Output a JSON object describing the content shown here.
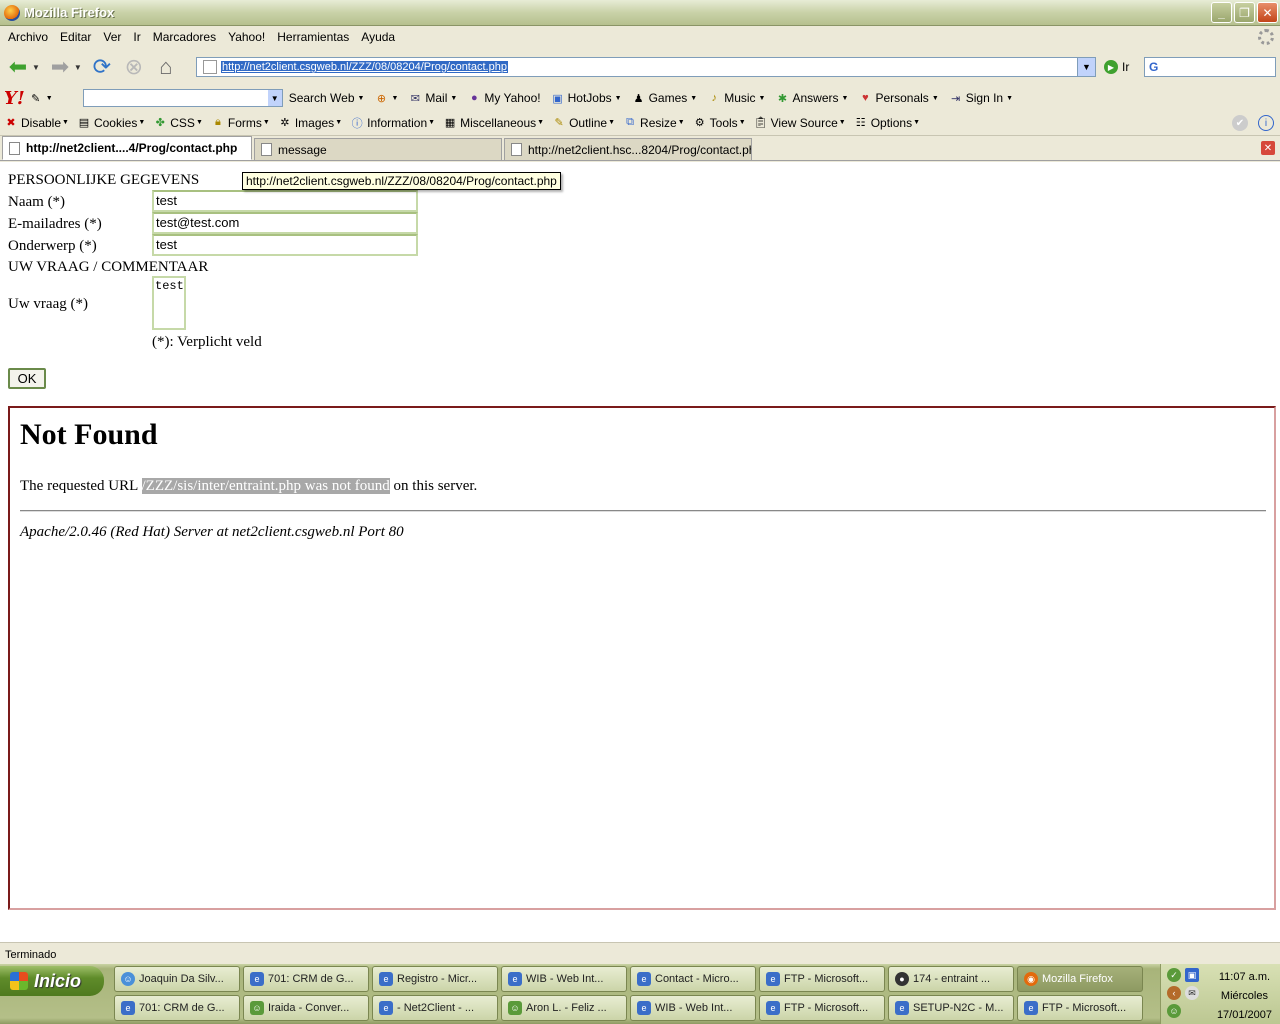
{
  "window": {
    "title": "Mozilla Firefox",
    "buttons": [
      "_",
      "❐",
      "✕"
    ]
  },
  "menu": [
    "Archivo",
    "Editar",
    "Ver",
    "Ir",
    "Marcadores",
    "Yahoo!",
    "Herramientas",
    "Ayuda"
  ],
  "nav": {
    "url": "http://net2client.csgweb.nl/ZZZ/08/08204/Prog/contact.php",
    "go_label": "Ir",
    "search_engine_letter": "G"
  },
  "yahoo_toolbar": {
    "logo": "Y!",
    "items": [
      "Search Web",
      "Mail",
      "My Yahoo!",
      "HotJobs",
      "Games",
      "Music",
      "Answers",
      "Personals",
      "Sign In"
    ]
  },
  "dev_toolbar": {
    "items": [
      "Disable",
      "Cookies",
      "CSS",
      "Forms",
      "Images",
      "Information",
      "Miscellaneous",
      "Outline",
      "Resize",
      "Tools",
      "View Source",
      "Options"
    ]
  },
  "tabs": [
    {
      "label": "http://net2client....4/Prog/contact.php",
      "active": true
    },
    {
      "label": "message",
      "active": false
    },
    {
      "label": "http://net2client.hsc...8204/Prog/contact.php",
      "active": false
    }
  ],
  "tooltip": "http://net2client.csgweb.nl/ZZZ/08/08204/Prog/contact.php",
  "form": {
    "section1": "PERSOONLIJKE GEGEVENS",
    "name_label": "Naam (*)",
    "name_value": "test",
    "email_label": "E-mailadres (*)",
    "email_value": "test@test.com",
    "subject_label": "Onderwerp (*)",
    "subject_value": "test",
    "section2": "UW VRAAG / COMMENTAAR",
    "question_label": "Uw vraag (*)",
    "question_value": "test",
    "required_note": "(*): Verplicht veld",
    "ok_label": "OK"
  },
  "error_page": {
    "heading": "Not Found",
    "msg_before": "The requested URL ",
    "msg_highlight": "/ZZZ/sis/inter/entraint.php was not found",
    "msg_after": " on this server.",
    "address": "Apache/2.0.46 (Red Hat) Server at net2client.csgweb.nl Port 80"
  },
  "status": "Terminado",
  "taskbar": {
    "start": "Inicio",
    "row1": [
      "Joaquin Da Silv...",
      "701: CRM de G...",
      "Registro - Micr...",
      "WIB - Web Int...",
      "Contact - Micro...",
      "FTP - Microsoft...",
      "174 - entraint ...",
      "Mozilla Firefox"
    ],
    "row2": [
      "701: CRM de G...",
      "Iraida - Conver...",
      "- Net2Client - ...",
      "Aron L. - Feliz ...",
      "WIB - Web Int...",
      "FTP - Microsoft...",
      "SETUP-N2C - M...",
      "FTP - Microsoft..."
    ],
    "clock_time": "11:07 a.m.",
    "clock_day": "Miércoles",
    "clock_date": "17/01/2007"
  }
}
